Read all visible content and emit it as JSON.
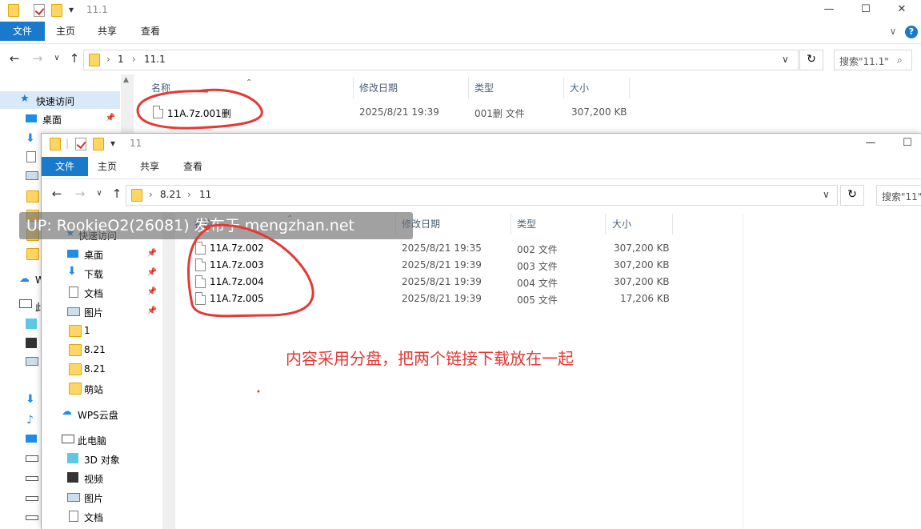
{
  "back_window": {
    "title": "11.1",
    "ribbon_tabs": [
      "文件",
      "主页",
      "共享",
      "查看"
    ],
    "breadcrumb": [
      "1",
      "11.1"
    ],
    "search_placeholder": "搜索\"11.1\"",
    "columns": [
      "名称",
      "修改日期",
      "类型",
      "大小"
    ],
    "rows": [
      {
        "name": "11A.7z.001删",
        "date": "2025/8/21 19:39",
        "type": "001删 文件",
        "size": "307,200 KB"
      }
    ],
    "nav": [
      {
        "label": "快速访问",
        "icon": "star-icon"
      },
      {
        "label": "桌面",
        "icon": "desktop-icon"
      }
    ]
  },
  "front_window": {
    "title": "11",
    "ribbon_tabs": [
      "文件",
      "主页",
      "共享",
      "查看"
    ],
    "breadcrumb": [
      "8.21",
      "11"
    ],
    "search_placeholder": "搜索\"11\"",
    "columns": [
      "名称",
      "修改日期",
      "类型",
      "大小"
    ],
    "rows": [
      {
        "name": "11A.7z.002",
        "date": "2025/8/21 19:35",
        "type": "002 文件",
        "size": "307,200 KB"
      },
      {
        "name": "11A.7z.003",
        "date": "2025/8/21 19:39",
        "type": "003 文件",
        "size": "307,200 KB"
      },
      {
        "name": "11A.7z.004",
        "date": "2025/8/21 19:39",
        "type": "004 文件",
        "size": "307,200 KB"
      },
      {
        "name": "11A.7z.005",
        "date": "2025/8/21 19:39",
        "type": "005 文件",
        "size": "17,206 KB"
      }
    ],
    "nav": [
      {
        "label": "快速访问",
        "icon": "star-icon"
      },
      {
        "label": "桌面",
        "icon": "desktop-icon"
      },
      {
        "label": "下载",
        "icon": "download-icon"
      },
      {
        "label": "文档",
        "icon": "document-icon"
      },
      {
        "label": "图片",
        "icon": "picture-icon"
      },
      {
        "label": "1",
        "icon": "folder-icon"
      },
      {
        "label": "8.21",
        "icon": "folder-icon"
      },
      {
        "label": "8.21",
        "icon": "folder-icon"
      },
      {
        "label": "萌站",
        "icon": "folder-icon"
      },
      {
        "label": "WPS云盘",
        "icon": "cloud-icon"
      },
      {
        "label": "此电脑",
        "icon": "computer-icon"
      },
      {
        "label": "3D 对象",
        "icon": "cube-icon"
      },
      {
        "label": "视频",
        "icon": "video-icon"
      },
      {
        "label": "图片",
        "icon": "picture-icon"
      },
      {
        "label": "文档",
        "icon": "document-icon"
      }
    ]
  },
  "watermark": "UP: RookieO2(26081) 发布于 mengzhan.net",
  "annotation": "内容采用分盘，把两个链接下载放在一起",
  "colors": {
    "accent": "#1979ca",
    "annotation": "#e53935",
    "selection": "#d9e9f7"
  }
}
